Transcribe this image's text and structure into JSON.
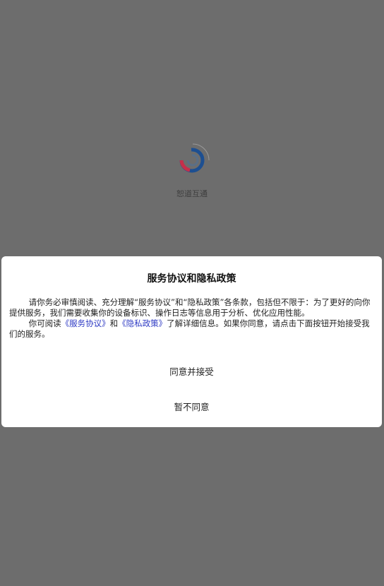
{
  "splash": {
    "logo_icon": "swirl-c-logo-icon",
    "app_name": "恕道互通"
  },
  "dialog": {
    "title": "服务协议和隐私政策",
    "paragraph1": "请你务必审慎阅读、充分理解“服务协议”和“隐私政策”各条款，包括但不限于：为了更好的向你提供服务，我们需要收集你的设备标识、操作日志等信息用于分析、优化应用性能。",
    "paragraph2_prefix": "你可阅读",
    "service_agreement_link": "《服务协议》",
    "and_text": "和",
    "privacy_policy_link": "《隐私政策》",
    "paragraph2_suffix": "了解详细信息。如果你同意，请点击下面按钮开始接受我们的服务。",
    "agree_button": "同意并接受",
    "disagree_button": "暂不同意"
  },
  "colors": {
    "overlay": "#6d6d6d",
    "link": "#2f3bc4",
    "logo_blue": "#1d4f91",
    "logo_red": "#c62f4a"
  }
}
